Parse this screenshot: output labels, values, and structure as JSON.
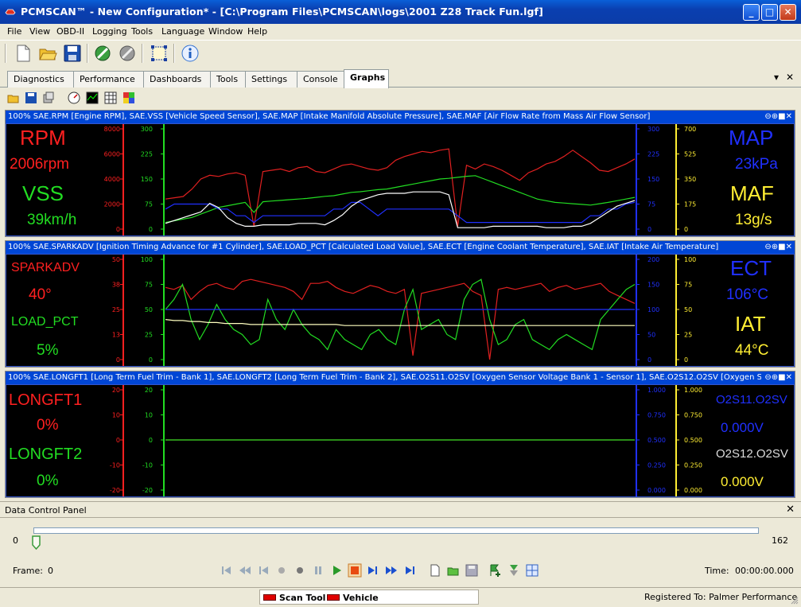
{
  "window": {
    "title": "PCMSCAN™ - New Configuration* - [C:\\Program Files\\PCMSCAN\\logs\\2001 Z28 Track Fun.lgf]",
    "min": "_",
    "max": "□",
    "close": "✕"
  },
  "menu": [
    "File",
    "View",
    "OBD-II",
    "Logging",
    "Tools",
    "Language",
    "Window",
    "Help"
  ],
  "tabs": [
    "Diagnostics",
    "Performance",
    "Dashboards",
    "Tools",
    "Settings",
    "Console",
    "Graphs"
  ],
  "active_tab": "Graphs",
  "panels": [
    {
      "header": "100% SAE.RPM [Engine RPM], SAE.VSS [Vehicle Speed Sensor], SAE.MAP [Intake Manifold Absolute Pressure], SAE.MAF [Air Flow Rate from Mass Air Flow Sensor]",
      "left": [
        {
          "label": "RPM",
          "value": "2006rpm",
          "color": "#ff2020"
        },
        {
          "label": "VSS",
          "value": "39km/h",
          "color": "#22dd22"
        }
      ],
      "right": [
        {
          "label": "MAP",
          "value": "23kPa",
          "color": "#2030ff"
        },
        {
          "label": "MAF",
          "value": "13g/s",
          "color": "#ffee33"
        }
      ],
      "axes": {
        "a": {
          "ticks": [
            "8000",
            "6000",
            "4000",
            "2000",
            "0"
          ],
          "color": "#ff2020"
        },
        "b": {
          "ticks": [
            "300",
            "225",
            "150",
            "75",
            "0"
          ],
          "color": "#22dd22"
        },
        "c": {
          "ticks": [
            "300",
            "225",
            "150",
            "75",
            "0"
          ],
          "color": "#2030ff"
        },
        "d": {
          "ticks": [
            "700",
            "525",
            "350",
            "175",
            "0"
          ],
          "color": "#ffee33"
        }
      }
    },
    {
      "header": "100% SAE.SPARKADV [Ignition Timing Advance for #1 Cylinder], SAE.LOAD_PCT [Calculated Load Value], SAE.ECT [Engine Coolant Temperature], SAE.IAT [Intake Air Temperature]",
      "left": [
        {
          "label": "SPARKADV",
          "value": "40°",
          "color": "#ff2020"
        },
        {
          "label": "LOAD_PCT",
          "value": "5%",
          "color": "#22dd22"
        }
      ],
      "right": [
        {
          "label": "ECT",
          "value": "106°C",
          "color": "#2030ff"
        },
        {
          "label": "IAT",
          "value": "44°C",
          "color": "#ffee33"
        }
      ],
      "axes": {
        "a": {
          "ticks": [
            "50",
            "38",
            "25",
            "13",
            "0"
          ],
          "color": "#ff2020"
        },
        "b": {
          "ticks": [
            "100",
            "75",
            "50",
            "25",
            "0"
          ],
          "color": "#22dd22"
        },
        "c": {
          "ticks": [
            "200",
            "150",
            "100",
            "50",
            "0"
          ],
          "color": "#2030ff"
        },
        "d": {
          "ticks": [
            "100",
            "75",
            "50",
            "25",
            "0"
          ],
          "color": "#ffee33"
        }
      }
    },
    {
      "header": "100% SAE.LONGFT1 [Long Term Fuel Trim - Bank 1], SAE.LONGFT2 [Long Term Fuel Trim - Bank 2], SAE.O2S11.O2SV [Oxygen Sensor Voltage Bank 1 - Sensor 1], SAE.O2S12.O2SV [Oxygen S...",
      "left": [
        {
          "label": "LONGFT1",
          "value": "0%",
          "color": "#ff2020"
        },
        {
          "label": "LONGFT2",
          "value": "0%",
          "color": "#22dd22"
        }
      ],
      "right": [
        {
          "label": "O2S11.O2SV",
          "value": "0.000V",
          "color": "#2030ff"
        },
        {
          "label": "O2S12.O2SV",
          "value": "0.000V",
          "color": "#ffee33"
        }
      ],
      "axes": {
        "a": {
          "ticks": [
            "20",
            "10",
            "0",
            "-10",
            "-20"
          ],
          "color": "#ff2020"
        },
        "b": {
          "ticks": [
            "20",
            "10",
            "0",
            "-10",
            "-20"
          ],
          "color": "#22dd22"
        },
        "c": {
          "ticks": [
            "1.000",
            "0.750",
            "0.500",
            "0.250",
            "0.000"
          ],
          "color": "#2030ff"
        },
        "d": {
          "ticks": [
            "1.000",
            "0.750",
            "0.500",
            "0.250",
            "0.000"
          ],
          "color": "#ffee33"
        }
      }
    }
  ],
  "dcp": {
    "title": "Data Control Panel",
    "close": "✕",
    "slider_min": "0",
    "slider_max": "162",
    "slider_value": 0,
    "frame_label": "Frame:",
    "frame_value": "0",
    "time_label": "Time:",
    "time_value": "00:00:00.000"
  },
  "status": {
    "legend": [
      "Scan Tool",
      "Vehicle"
    ],
    "registered": "Registered To: Palmer Performance"
  },
  "chart_data": [
    {
      "type": "line",
      "series": [
        {
          "name": "RPM",
          "y": [
            2400,
            2500,
            2600,
            3200,
            4000,
            4300,
            4200,
            4400,
            4500,
            4300,
            200,
            4600,
            4700,
            4800,
            4600,
            4900,
            5000,
            4600,
            4500,
            4800,
            5100,
            5200,
            5000,
            4800,
            4700,
            4900,
            5500,
            5800,
            6000,
            6200,
            6100,
            6300,
            6400,
            200,
            5100,
            4800,
            5200,
            5000,
            4700,
            4300,
            3900,
            4500,
            4800,
            5200,
            5400,
            5800,
            6300,
            5800,
            5300,
            4700,
            4600,
            4900,
            5200,
            5600
          ]
        },
        {
          "name": "VSS",
          "y": [
            20,
            25,
            30,
            35,
            45,
            55,
            65,
            70,
            75,
            80,
            50,
            82,
            84,
            86,
            88,
            90,
            92,
            95,
            98,
            100,
            105,
            110,
            112,
            115,
            118,
            120,
            125,
            130,
            135,
            140,
            145,
            150,
            152,
            155,
            158,
            160,
            150,
            140,
            130,
            120,
            110,
            100,
            90,
            85,
            80,
            78,
            76,
            74,
            72,
            76,
            80,
            85,
            90,
            95
          ]
        },
        {
          "name": "MAP",
          "y": [
            60,
            75,
            75,
            75,
            75,
            75,
            60,
            60,
            40,
            40,
            20,
            40,
            40,
            40,
            40,
            40,
            40,
            40,
            40,
            60,
            60,
            80,
            80,
            60,
            40,
            60,
            60,
            60,
            60,
            60,
            60,
            60,
            60,
            40,
            20,
            20,
            20,
            20,
            20,
            20,
            20,
            20,
            20,
            20,
            20,
            20,
            20,
            20,
            40,
            40,
            60,
            60,
            75,
            80
          ]
        },
        {
          "name": "MAF",
          "y": [
            40,
            60,
            80,
            100,
            120,
            180,
            150,
            80,
            40,
            20,
            20,
            30,
            30,
            30,
            30,
            40,
            40,
            40,
            30,
            60,
            100,
            160,
            200,
            220,
            240,
            250,
            250,
            250,
            260,
            260,
            260,
            260,
            240,
            10,
            10,
            10,
            10,
            20,
            20,
            20,
            20,
            20,
            20,
            10,
            10,
            10,
            20,
            20,
            40,
            80,
            120,
            160,
            180,
            200
          ]
        }
      ]
    },
    {
      "type": "line",
      "series": [
        {
          "name": "SPARKADV",
          "y": [
            36,
            35,
            37,
            30,
            34,
            37,
            38,
            36,
            35,
            39,
            40,
            39,
            38,
            37,
            36,
            34,
            30,
            38,
            38,
            39,
            36,
            34,
            33,
            35,
            37,
            36,
            34,
            33,
            35,
            2,
            33,
            34,
            35,
            36,
            37,
            38,
            34,
            32,
            0,
            35,
            36,
            35,
            36,
            37,
            38,
            34,
            36,
            37,
            35,
            36,
            37,
            38,
            34,
            32,
            30,
            28
          ]
        },
        {
          "name": "LOAD_PCT",
          "y": [
            50,
            60,
            75,
            40,
            20,
            35,
            55,
            40,
            30,
            25,
            15,
            20,
            60,
            40,
            30,
            50,
            35,
            25,
            20,
            10,
            30,
            20,
            15,
            10,
            25,
            30,
            20,
            15,
            50,
            70,
            30,
            35,
            40,
            25,
            20,
            60,
            75,
            80,
            40,
            15,
            20,
            35,
            40,
            20,
            15,
            10,
            20,
            25,
            20,
            15,
            10,
            40,
            50,
            60,
            70,
            75
          ]
        },
        {
          "name": "ECT",
          "y": [
            100,
            100,
            100,
            100,
            100,
            100,
            100,
            100,
            100,
            100,
            100,
            100,
            100,
            100,
            100,
            100,
            100,
            100,
            100,
            100,
            100,
            100,
            100,
            100,
            100,
            100,
            100,
            100,
            100,
            100,
            100,
            100,
            100,
            100,
            100,
            100,
            100,
            100,
            100,
            100,
            100,
            100,
            100,
            100,
            100,
            100,
            100,
            100,
            100,
            100,
            100,
            100,
            100,
            100,
            100,
            100
          ]
        },
        {
          "name": "IAT",
          "y": [
            40,
            39,
            39,
            38,
            38,
            37,
            37,
            36,
            36,
            36,
            35,
            35,
            35,
            35,
            35,
            35,
            35,
            35,
            35,
            35,
            35,
            34,
            34,
            34,
            34,
            34,
            34,
            34,
            34,
            34,
            34,
            34,
            34,
            34,
            34,
            34,
            34,
            34,
            34,
            34,
            34,
            34,
            34,
            34,
            34,
            34,
            34,
            34,
            34,
            34,
            34,
            34,
            34,
            34,
            34,
            34
          ]
        }
      ]
    },
    {
      "type": "line",
      "series": [
        {
          "name": "LONGFT1",
          "y": [
            0,
            0,
            0,
            0,
            0,
            0,
            0,
            0,
            0,
            0
          ]
        },
        {
          "name": "LONGFT2",
          "y": [
            0,
            0,
            0,
            0,
            0,
            0,
            0,
            0,
            0,
            0
          ]
        }
      ]
    }
  ]
}
